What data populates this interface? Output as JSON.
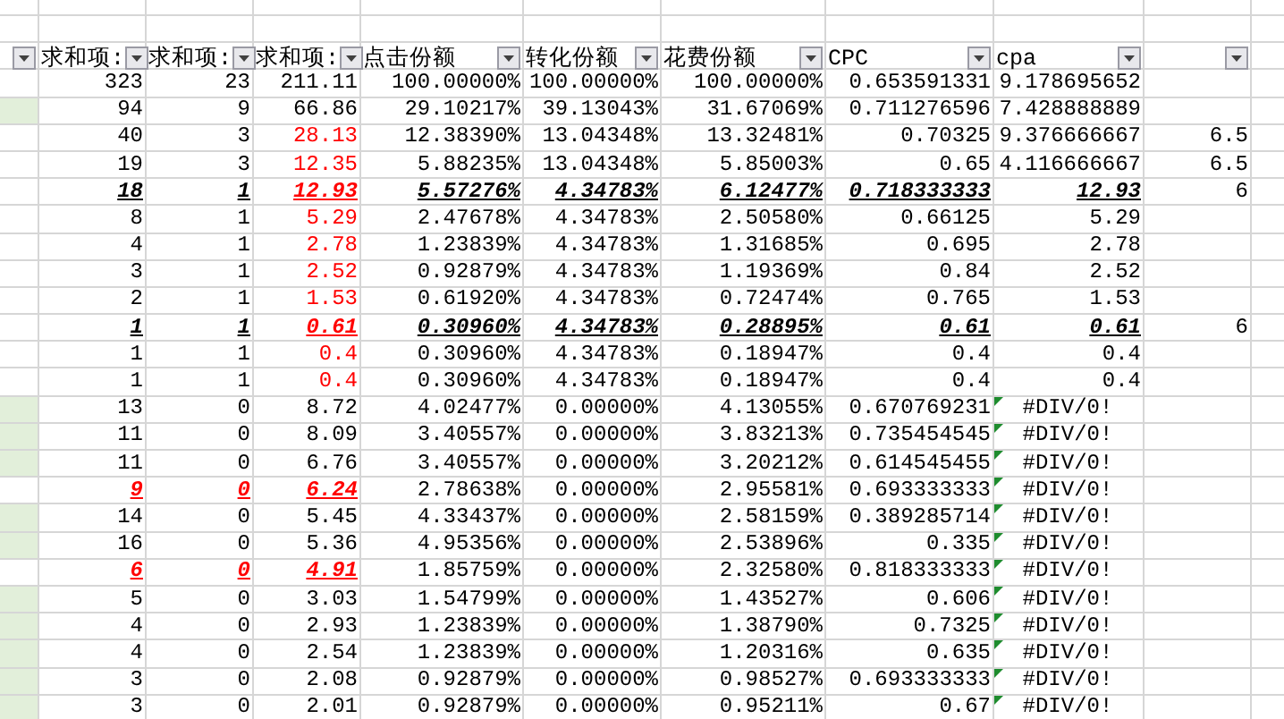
{
  "header": {
    "columns": [
      {
        "filter": true
      },
      {
        "label": "求和项:",
        "filter": true
      },
      {
        "label": "求和项:",
        "filter": true
      },
      {
        "label": "求和项:",
        "filter": true
      },
      {
        "label": "点击份额",
        "filter": true
      },
      {
        "label": "转化份额",
        "filter": true
      },
      {
        "label": "花费份额",
        "filter": true
      },
      {
        "label": "CPC",
        "filter": true
      },
      {
        "label": "cpa",
        "filter": true
      },
      {
        "filter": true
      }
    ]
  },
  "table": {
    "rows": [
      {
        "first_column_shaded": false,
        "error_indicator": false,
        "cells": [
          {
            "value": "323",
            "flagged": false,
            "emphasized": false
          },
          {
            "value": "23",
            "flagged": false,
            "emphasized": false
          },
          {
            "value": "211.11",
            "flagged": false,
            "emphasized": false
          },
          {
            "value": "100.00000%",
            "flagged": false,
            "emphasized": false
          },
          {
            "value": "100.00000%",
            "flagged": false,
            "emphasized": false
          },
          {
            "value": "100.00000%",
            "flagged": false,
            "emphasized": false
          },
          {
            "value": "0.653591331",
            "flagged": false,
            "emphasized": false
          },
          {
            "value": "9.178695652",
            "flagged": false,
            "emphasized": false
          }
        ]
      },
      {
        "first_column_shaded": true,
        "error_indicator": false,
        "cells": [
          {
            "value": "94",
            "flagged": false,
            "emphasized": false
          },
          {
            "value": "9",
            "flagged": false,
            "emphasized": false
          },
          {
            "value": "66.86",
            "flagged": false,
            "emphasized": false
          },
          {
            "value": "29.10217%",
            "flagged": false,
            "emphasized": false
          },
          {
            "value": "39.13043%",
            "flagged": false,
            "emphasized": false
          },
          {
            "value": "31.67069%",
            "flagged": false,
            "emphasized": false
          },
          {
            "value": "0.711276596",
            "flagged": false,
            "emphasized": false
          },
          {
            "value": "7.428888889",
            "flagged": false,
            "emphasized": false
          }
        ]
      },
      {
        "first_column_shaded": false,
        "error_indicator": false,
        "cells": [
          {
            "value": "40",
            "flagged": false,
            "emphasized": false
          },
          {
            "value": "3",
            "flagged": false,
            "emphasized": false
          },
          {
            "value": "28.13",
            "flagged": true,
            "emphasized": false
          },
          {
            "value": "12.38390%",
            "flagged": false,
            "emphasized": false
          },
          {
            "value": "13.04348%",
            "flagged": false,
            "emphasized": false
          },
          {
            "value": "13.32481%",
            "flagged": false,
            "emphasized": false
          },
          {
            "value": "0.70325",
            "flagged": false,
            "emphasized": false
          },
          {
            "value": "9.376666667",
            "flagged": false,
            "emphasized": false
          },
          {
            "value": "6.5",
            "flagged": false,
            "emphasized": false
          }
        ]
      },
      {
        "first_column_shaded": false,
        "error_indicator": false,
        "cells": [
          {
            "value": "19",
            "flagged": false,
            "emphasized": false
          },
          {
            "value": "3",
            "flagged": false,
            "emphasized": false
          },
          {
            "value": "12.35",
            "flagged": true,
            "emphasized": false
          },
          {
            "value": "5.88235%",
            "flagged": false,
            "emphasized": false
          },
          {
            "value": "13.04348%",
            "flagged": false,
            "emphasized": false
          },
          {
            "value": "5.85003%",
            "flagged": false,
            "emphasized": false
          },
          {
            "value": "0.65",
            "flagged": false,
            "emphasized": false
          },
          {
            "value": "4.116666667",
            "flagged": false,
            "emphasized": false
          },
          {
            "value": "6.5",
            "flagged": false,
            "emphasized": false
          }
        ]
      },
      {
        "first_column_shaded": false,
        "error_indicator": false,
        "cells": [
          {
            "value": "18",
            "flagged": false,
            "emphasized": true
          },
          {
            "value": "1",
            "flagged": false,
            "emphasized": true
          },
          {
            "value": "12.93",
            "flagged": true,
            "emphasized": true
          },
          {
            "value": "5.57276%",
            "flagged": false,
            "emphasized": true
          },
          {
            "value": "4.34783%",
            "flagged": false,
            "emphasized": true
          },
          {
            "value": "6.12477%",
            "flagged": false,
            "emphasized": true
          },
          {
            "value": "0.718333333",
            "flagged": false,
            "emphasized": true
          },
          {
            "value": "12.93",
            "flagged": false,
            "emphasized": true
          },
          {
            "value": "6",
            "flagged": false,
            "emphasized": false
          }
        ]
      },
      {
        "first_column_shaded": false,
        "error_indicator": false,
        "cells": [
          {
            "value": "8",
            "flagged": false,
            "emphasized": false
          },
          {
            "value": "1",
            "flagged": false,
            "emphasized": false
          },
          {
            "value": "5.29",
            "flagged": true,
            "emphasized": false
          },
          {
            "value": "2.47678%",
            "flagged": false,
            "emphasized": false
          },
          {
            "value": "4.34783%",
            "flagged": false,
            "emphasized": false
          },
          {
            "value": "2.50580%",
            "flagged": false,
            "emphasized": false
          },
          {
            "value": "0.66125",
            "flagged": false,
            "emphasized": false
          },
          {
            "value": "5.29",
            "flagged": false,
            "emphasized": false
          }
        ]
      },
      {
        "first_column_shaded": false,
        "error_indicator": false,
        "cells": [
          {
            "value": "4",
            "flagged": false,
            "emphasized": false
          },
          {
            "value": "1",
            "flagged": false,
            "emphasized": false
          },
          {
            "value": "2.78",
            "flagged": true,
            "emphasized": false
          },
          {
            "value": "1.23839%",
            "flagged": false,
            "emphasized": false
          },
          {
            "value": "4.34783%",
            "flagged": false,
            "emphasized": false
          },
          {
            "value": "1.31685%",
            "flagged": false,
            "emphasized": false
          },
          {
            "value": "0.695",
            "flagged": false,
            "emphasized": false
          },
          {
            "value": "2.78",
            "flagged": false,
            "emphasized": false
          }
        ]
      },
      {
        "first_column_shaded": false,
        "error_indicator": false,
        "cells": [
          {
            "value": "3",
            "flagged": false,
            "emphasized": false
          },
          {
            "value": "1",
            "flagged": false,
            "emphasized": false
          },
          {
            "value": "2.52",
            "flagged": true,
            "emphasized": false
          },
          {
            "value": "0.92879%",
            "flagged": false,
            "emphasized": false
          },
          {
            "value": "4.34783%",
            "flagged": false,
            "emphasized": false
          },
          {
            "value": "1.19369%",
            "flagged": false,
            "emphasized": false
          },
          {
            "value": "0.84",
            "flagged": false,
            "emphasized": false
          },
          {
            "value": "2.52",
            "flagged": false,
            "emphasized": false
          }
        ]
      },
      {
        "first_column_shaded": false,
        "error_indicator": false,
        "cells": [
          {
            "value": "2",
            "flagged": false,
            "emphasized": false
          },
          {
            "value": "1",
            "flagged": false,
            "emphasized": false
          },
          {
            "value": "1.53",
            "flagged": true,
            "emphasized": false
          },
          {
            "value": "0.61920%",
            "flagged": false,
            "emphasized": false
          },
          {
            "value": "4.34783%",
            "flagged": false,
            "emphasized": false
          },
          {
            "value": "0.72474%",
            "flagged": false,
            "emphasized": false
          },
          {
            "value": "0.765",
            "flagged": false,
            "emphasized": false
          },
          {
            "value": "1.53",
            "flagged": false,
            "emphasized": false
          }
        ]
      },
      {
        "first_column_shaded": false,
        "error_indicator": false,
        "cells": [
          {
            "value": "1",
            "flagged": false,
            "emphasized": true
          },
          {
            "value": "1",
            "flagged": false,
            "emphasized": true
          },
          {
            "value": "0.61",
            "flagged": true,
            "emphasized": true
          },
          {
            "value": "0.30960%",
            "flagged": false,
            "emphasized": true
          },
          {
            "value": "4.34783%",
            "flagged": false,
            "emphasized": true
          },
          {
            "value": "0.28895%",
            "flagged": false,
            "emphasized": true
          },
          {
            "value": "0.61",
            "flagged": false,
            "emphasized": true
          },
          {
            "value": "0.61",
            "flagged": false,
            "emphasized": true
          },
          {
            "value": "6",
            "flagged": false,
            "emphasized": false
          }
        ]
      },
      {
        "first_column_shaded": false,
        "error_indicator": false,
        "cells": [
          {
            "value": "1",
            "flagged": false,
            "emphasized": false
          },
          {
            "value": "1",
            "flagged": false,
            "emphasized": false
          },
          {
            "value": "0.4",
            "flagged": true,
            "emphasized": false
          },
          {
            "value": "0.30960%",
            "flagged": false,
            "emphasized": false
          },
          {
            "value": "4.34783%",
            "flagged": false,
            "emphasized": false
          },
          {
            "value": "0.18947%",
            "flagged": false,
            "emphasized": false
          },
          {
            "value": "0.4",
            "flagged": false,
            "emphasized": false
          },
          {
            "value": "0.4",
            "flagged": false,
            "emphasized": false
          }
        ]
      },
      {
        "first_column_shaded": false,
        "error_indicator": false,
        "cells": [
          {
            "value": "1",
            "flagged": false,
            "emphasized": false
          },
          {
            "value": "1",
            "flagged": false,
            "emphasized": false
          },
          {
            "value": "0.4",
            "flagged": true,
            "emphasized": false
          },
          {
            "value": "0.30960%",
            "flagged": false,
            "emphasized": false
          },
          {
            "value": "4.34783%",
            "flagged": false,
            "emphasized": false
          },
          {
            "value": "0.18947%",
            "flagged": false,
            "emphasized": false
          },
          {
            "value": "0.4",
            "flagged": false,
            "emphasized": false
          },
          {
            "value": "0.4",
            "flagged": false,
            "emphasized": false
          }
        ]
      },
      {
        "first_column_shaded": true,
        "error_indicator": true,
        "cells": [
          {
            "value": "13",
            "flagged": false,
            "emphasized": false
          },
          {
            "value": "0",
            "flagged": false,
            "emphasized": false
          },
          {
            "value": "8.72",
            "flagged": false,
            "emphasized": false
          },
          {
            "value": "4.02477%",
            "flagged": false,
            "emphasized": false
          },
          {
            "value": "0.00000%",
            "flagged": false,
            "emphasized": false
          },
          {
            "value": "4.13055%",
            "flagged": false,
            "emphasized": false
          },
          {
            "value": "0.670769231",
            "flagged": false,
            "emphasized": false
          },
          {
            "value": "#DIV/0!",
            "flagged": false,
            "emphasized": false
          }
        ]
      },
      {
        "first_column_shaded": true,
        "error_indicator": true,
        "cells": [
          {
            "value": "11",
            "flagged": false,
            "emphasized": false
          },
          {
            "value": "0",
            "flagged": false,
            "emphasized": false
          },
          {
            "value": "8.09",
            "flagged": false,
            "emphasized": false
          },
          {
            "value": "3.40557%",
            "flagged": false,
            "emphasized": false
          },
          {
            "value": "0.00000%",
            "flagged": false,
            "emphasized": false
          },
          {
            "value": "3.83213%",
            "flagged": false,
            "emphasized": false
          },
          {
            "value": "0.735454545",
            "flagged": false,
            "emphasized": false
          },
          {
            "value": "#DIV/0!",
            "flagged": false,
            "emphasized": false
          }
        ]
      },
      {
        "first_column_shaded": true,
        "error_indicator": true,
        "cells": [
          {
            "value": "11",
            "flagged": false,
            "emphasized": false
          },
          {
            "value": "0",
            "flagged": false,
            "emphasized": false
          },
          {
            "value": "6.76",
            "flagged": false,
            "emphasized": false
          },
          {
            "value": "3.40557%",
            "flagged": false,
            "emphasized": false
          },
          {
            "value": "0.00000%",
            "flagged": false,
            "emphasized": false
          },
          {
            "value": "3.20212%",
            "flagged": false,
            "emphasized": false
          },
          {
            "value": "0.614545455",
            "flagged": false,
            "emphasized": false
          },
          {
            "value": "#DIV/0!",
            "flagged": false,
            "emphasized": false
          }
        ]
      },
      {
        "first_column_shaded": false,
        "error_indicator": true,
        "cells": [
          {
            "value": "9",
            "flagged": true,
            "emphasized": true
          },
          {
            "value": "0",
            "flagged": true,
            "emphasized": true
          },
          {
            "value": "6.24",
            "flagged": true,
            "emphasized": true
          },
          {
            "value": "2.78638%",
            "flagged": false,
            "emphasized": false
          },
          {
            "value": "0.00000%",
            "flagged": false,
            "emphasized": false
          },
          {
            "value": "2.95581%",
            "flagged": false,
            "emphasized": false
          },
          {
            "value": "0.693333333",
            "flagged": false,
            "emphasized": false
          },
          {
            "value": "#DIV/0!",
            "flagged": false,
            "emphasized": false
          }
        ]
      },
      {
        "first_column_shaded": true,
        "error_indicator": true,
        "cells": [
          {
            "value": "14",
            "flagged": false,
            "emphasized": false
          },
          {
            "value": "0",
            "flagged": false,
            "emphasized": false
          },
          {
            "value": "5.45",
            "flagged": false,
            "emphasized": false
          },
          {
            "value": "4.33437%",
            "flagged": false,
            "emphasized": false
          },
          {
            "value": "0.00000%",
            "flagged": false,
            "emphasized": false
          },
          {
            "value": "2.58159%",
            "flagged": false,
            "emphasized": false
          },
          {
            "value": "0.389285714",
            "flagged": false,
            "emphasized": false
          },
          {
            "value": "#DIV/0!",
            "flagged": false,
            "emphasized": false
          }
        ]
      },
      {
        "first_column_shaded": true,
        "error_indicator": true,
        "cells": [
          {
            "value": "16",
            "flagged": false,
            "emphasized": false
          },
          {
            "value": "0",
            "flagged": false,
            "emphasized": false
          },
          {
            "value": "5.36",
            "flagged": false,
            "emphasized": false
          },
          {
            "value": "4.95356%",
            "flagged": false,
            "emphasized": false
          },
          {
            "value": "0.00000%",
            "flagged": false,
            "emphasized": false
          },
          {
            "value": "2.53896%",
            "flagged": false,
            "emphasized": false
          },
          {
            "value": "0.335",
            "flagged": false,
            "emphasized": false
          },
          {
            "value": "#DIV/0!",
            "flagged": false,
            "emphasized": false
          }
        ]
      },
      {
        "first_column_shaded": false,
        "error_indicator": true,
        "cells": [
          {
            "value": "6",
            "flagged": true,
            "emphasized": true
          },
          {
            "value": "0",
            "flagged": true,
            "emphasized": true
          },
          {
            "value": "4.91",
            "flagged": true,
            "emphasized": true
          },
          {
            "value": "1.85759%",
            "flagged": false,
            "emphasized": false
          },
          {
            "value": "0.00000%",
            "flagged": false,
            "emphasized": false
          },
          {
            "value": "2.32580%",
            "flagged": false,
            "emphasized": false
          },
          {
            "value": "0.818333333",
            "flagged": false,
            "emphasized": false
          },
          {
            "value": "#DIV/0!",
            "flagged": false,
            "emphasized": false
          }
        ]
      },
      {
        "first_column_shaded": true,
        "error_indicator": true,
        "cells": [
          {
            "value": "5",
            "flagged": false,
            "emphasized": false
          },
          {
            "value": "0",
            "flagged": false,
            "emphasized": false
          },
          {
            "value": "3.03",
            "flagged": false,
            "emphasized": false
          },
          {
            "value": "1.54799%",
            "flagged": false,
            "emphasized": false
          },
          {
            "value": "0.00000%",
            "flagged": false,
            "emphasized": false
          },
          {
            "value": "1.43527%",
            "flagged": false,
            "emphasized": false
          },
          {
            "value": "0.606",
            "flagged": false,
            "emphasized": false
          },
          {
            "value": "#DIV/0!",
            "flagged": false,
            "emphasized": false
          }
        ]
      },
      {
        "first_column_shaded": true,
        "error_indicator": true,
        "cells": [
          {
            "value": "4",
            "flagged": false,
            "emphasized": false
          },
          {
            "value": "0",
            "flagged": false,
            "emphasized": false
          },
          {
            "value": "2.93",
            "flagged": false,
            "emphasized": false
          },
          {
            "value": "1.23839%",
            "flagged": false,
            "emphasized": false
          },
          {
            "value": "0.00000%",
            "flagged": false,
            "emphasized": false
          },
          {
            "value": "1.38790%",
            "flagged": false,
            "emphasized": false
          },
          {
            "value": "0.7325",
            "flagged": false,
            "emphasized": false
          },
          {
            "value": "#DIV/0!",
            "flagged": false,
            "emphasized": false
          }
        ]
      },
      {
        "first_column_shaded": true,
        "error_indicator": true,
        "cells": [
          {
            "value": "4",
            "flagged": false,
            "emphasized": false
          },
          {
            "value": "0",
            "flagged": false,
            "emphasized": false
          },
          {
            "value": "2.54",
            "flagged": false,
            "emphasized": false
          },
          {
            "value": "1.23839%",
            "flagged": false,
            "emphasized": false
          },
          {
            "value": "0.00000%",
            "flagged": false,
            "emphasized": false
          },
          {
            "value": "1.20316%",
            "flagged": false,
            "emphasized": false
          },
          {
            "value": "0.635",
            "flagged": false,
            "emphasized": false
          },
          {
            "value": "#DIV/0!",
            "flagged": false,
            "emphasized": false
          }
        ]
      },
      {
        "first_column_shaded": true,
        "error_indicator": true,
        "cells": [
          {
            "value": "3",
            "flagged": false,
            "emphasized": false
          },
          {
            "value": "0",
            "flagged": false,
            "emphasized": false
          },
          {
            "value": "2.08",
            "flagged": false,
            "emphasized": false
          },
          {
            "value": "0.92879%",
            "flagged": false,
            "emphasized": false
          },
          {
            "value": "0.00000%",
            "flagged": false,
            "emphasized": false
          },
          {
            "value": "0.98527%",
            "flagged": false,
            "emphasized": false
          },
          {
            "value": "0.693333333",
            "flagged": false,
            "emphasized": false
          },
          {
            "value": "#DIV/0!",
            "flagged": false,
            "emphasized": false
          }
        ]
      },
      {
        "first_column_shaded": true,
        "error_indicator": true,
        "cells": [
          {
            "value": "3",
            "flagged": false,
            "emphasized": false
          },
          {
            "value": "0",
            "flagged": false,
            "emphasized": false
          },
          {
            "value": "2.01",
            "flagged": false,
            "emphasized": false
          },
          {
            "value": "0.92879%",
            "flagged": false,
            "emphasized": false
          },
          {
            "value": "0.00000%",
            "flagged": false,
            "emphasized": false
          },
          {
            "value": "0.95211%",
            "flagged": false,
            "emphasized": false
          },
          {
            "value": "0.67",
            "flagged": false,
            "emphasized": false
          },
          {
            "value": "#DIV/0!",
            "flagged": false,
            "emphasized": false
          }
        ]
      }
    ]
  }
}
